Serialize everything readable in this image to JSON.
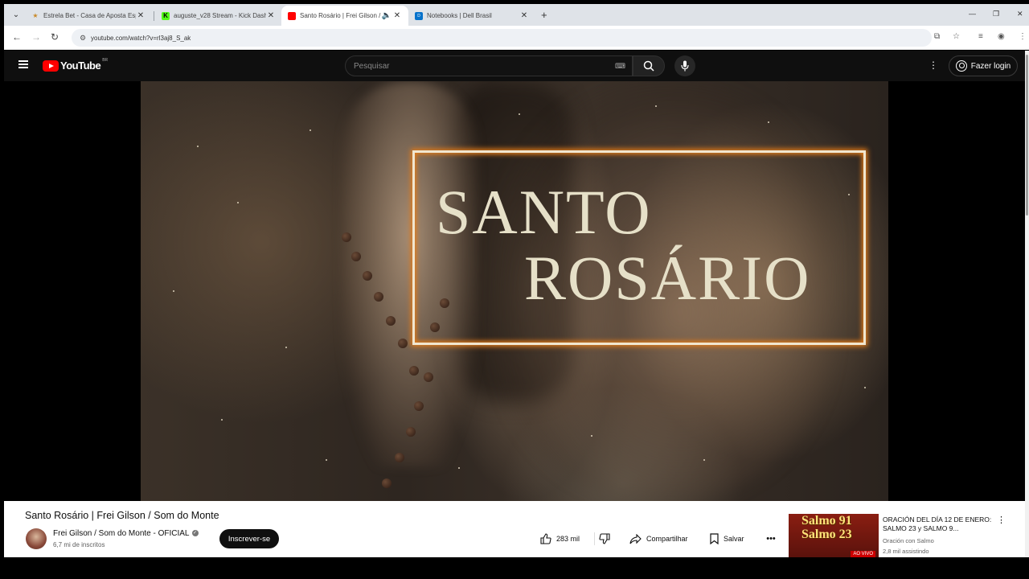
{
  "browser": {
    "tabs": [
      {
        "title": "Estrela Bet - Casa de Aposta Esp",
        "favicon": "star-icon"
      },
      {
        "title": "auguste_v28 Stream - Kick Dash",
        "favicon": "kick-icon"
      },
      {
        "title": "Santo Rosário | Frei Gilson /",
        "favicon": "youtube-icon"
      },
      {
        "title": "Notebooks | Dell Brasil",
        "favicon": "dell-icon"
      }
    ],
    "url": "youtube.com/watch?v=rl3aj8_S_ak"
  },
  "youtube": {
    "logo_text": "YouTube",
    "country_code": "BR",
    "search_placeholder": "Pesquisar",
    "login_label": "Fazer login"
  },
  "video": {
    "overlay_line1": "SANTO",
    "overlay_line2": "ROSÁRIO",
    "title": "Santo Rosário | Frei Gilson / Som do Monte",
    "channel_name": "Frei Gilson / Som do Monte - OFICIAL",
    "subscribers": "6,7 mi de inscritos",
    "subscribe_label": "Inscrever-se",
    "likes": "283 mil",
    "share_label": "Compartilhar",
    "save_label": "Salvar"
  },
  "recommendation": {
    "thumb_line1": "Salmo 91",
    "thumb_line2": "Salmo 23",
    "live_badge": "AO VIVO",
    "title": "ORACIÓN DEL DÍA 12 DE ENERO: SALMO 23 y SALMO 9...",
    "channel": "Oración con Salmo",
    "views": "2,8 mil assistindo"
  },
  "colors": {
    "youtube_red": "#ff0000",
    "header_bg": "#0f0f0f",
    "frame_orange": "#e07a1a"
  }
}
